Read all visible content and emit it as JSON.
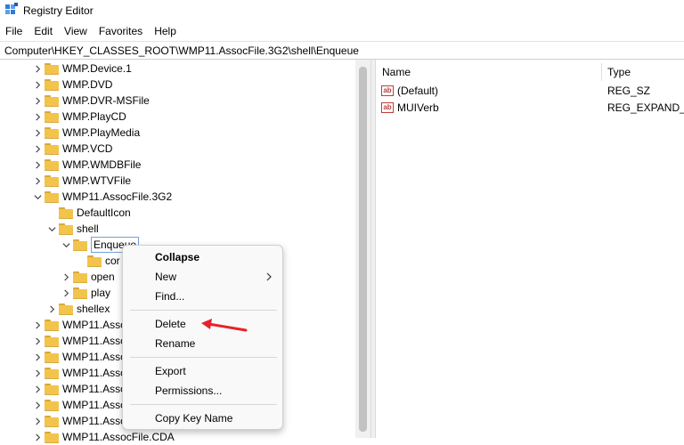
{
  "window": {
    "title": "Registry Editor"
  },
  "menubar": {
    "items": [
      "File",
      "Edit",
      "View",
      "Favorites",
      "Help"
    ]
  },
  "address": {
    "path": "Computer\\HKEY_CLASSES_ROOT\\WMP11.AssocFile.3G2\\shell\\Enqueue"
  },
  "tree": {
    "items": [
      {
        "label": "WMP.Device.1"
      },
      {
        "label": "WMP.DVD"
      },
      {
        "label": "WMP.DVR-MSFile"
      },
      {
        "label": "WMP.PlayCD"
      },
      {
        "label": "WMP.PlayMedia"
      },
      {
        "label": "WMP.VCD"
      },
      {
        "label": "WMP.WMDBFile"
      },
      {
        "label": "WMP.WTVFile"
      },
      {
        "label": "WMP11.AssocFile.3G2"
      },
      {
        "label": "DefaultIcon"
      },
      {
        "label": "shell"
      },
      {
        "label": "Enqueue"
      },
      {
        "label": "cor"
      },
      {
        "label": "open"
      },
      {
        "label": "play"
      },
      {
        "label": "shellex"
      },
      {
        "label": "WMP11.Assoc"
      },
      {
        "label": "WMP11.Assoc"
      },
      {
        "label": "WMP11.Assoc"
      },
      {
        "label": "WMP11.Assoc"
      },
      {
        "label": "WMP11.Assoc"
      },
      {
        "label": "WMP11.Assoc"
      },
      {
        "label": "WMP11.Assoc"
      },
      {
        "label": "WMP11.AssocFile.CDA"
      }
    ]
  },
  "list": {
    "columns": [
      "Name",
      "Type"
    ],
    "rows": [
      {
        "name": "(Default)",
        "type": "REG_SZ",
        "icon": "string-value-icon"
      },
      {
        "name": "MUIVerb",
        "type": "REG_EXPAND_SZ",
        "icon": "string-value-icon"
      }
    ],
    "ab_glyph": "ab"
  },
  "context_menu": {
    "items": [
      "Collapse",
      "New",
      "Find...",
      "Delete",
      "Rename",
      "Export",
      "Permissions...",
      "Copy Key Name"
    ]
  },
  "colors": {
    "selection_border": "#6fa1d8",
    "folder": "#f3c44b",
    "annotation_arrow": "#e8212a",
    "string_icon": "#bf3b3b"
  }
}
